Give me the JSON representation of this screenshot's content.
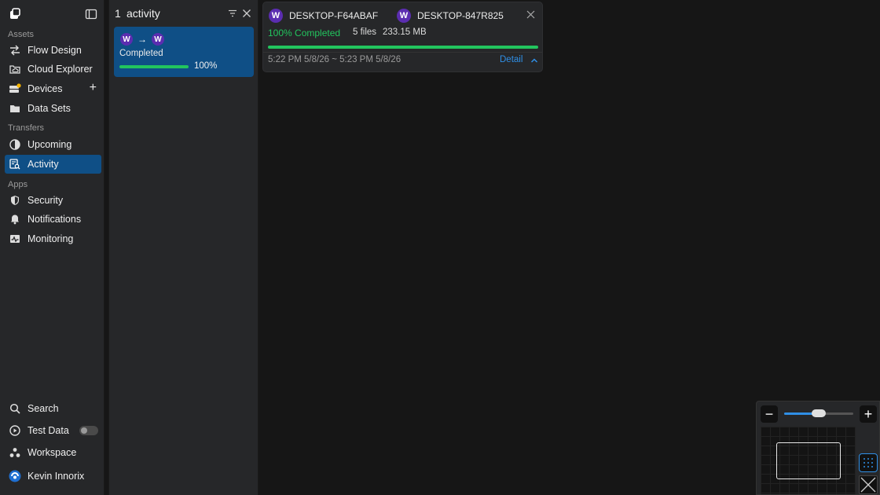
{
  "sidebar": {
    "sections": {
      "assets": "Assets",
      "transfers": "Transfers",
      "apps": "Apps"
    },
    "items": {
      "flow_design": "Flow Design",
      "cloud_explorer": "Cloud Explorer",
      "devices": "Devices",
      "data_sets": "Data Sets",
      "upcoming": "Upcoming",
      "activity": "Activity",
      "security": "Security",
      "notifications": "Notifications",
      "monitoring": "Monitoring",
      "search": "Search",
      "test_data": "Test Data",
      "workspace": "Workspace",
      "user": "Kevin Innorix"
    },
    "devices_add": "+"
  },
  "activity_list": {
    "count": "1",
    "title": "activity",
    "card": {
      "from_initial": "W",
      "arrow": "→",
      "to_initial": "W",
      "status": "Completed",
      "progress_pct": 100,
      "progress_label": "100%"
    }
  },
  "detail": {
    "source_initial": "W",
    "source_name": "DESKTOP-F64ABAF",
    "target_initial": "W",
    "target_name": "DESKTOP-847R825",
    "status": "100% Completed",
    "files": "5 files",
    "size": "233.15 MB",
    "progress_pct": 100,
    "time_range": "5:22 PM 5/8/26 ~ 5:23 PM 5/8/26",
    "detail_link": "Detail"
  },
  "zoom": {
    "minus": "−",
    "plus": "+",
    "level_fraction": 0.5
  },
  "colors": {
    "accent": "#0f4f86",
    "success": "#22c55e",
    "link": "#2f8fe6",
    "avatar": "#5b2db0"
  }
}
